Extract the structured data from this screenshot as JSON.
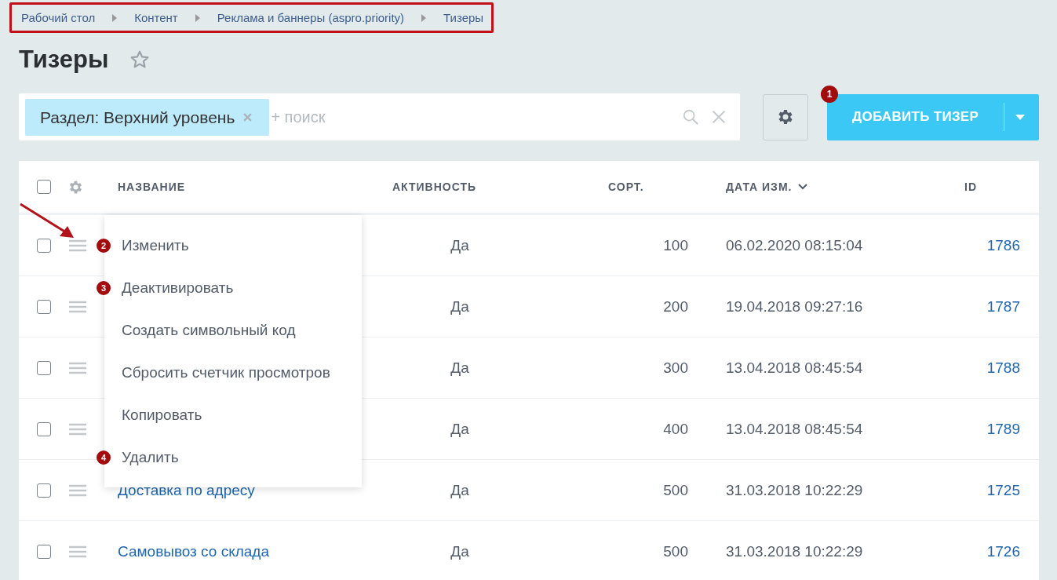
{
  "breadcrumb": {
    "outlined": true,
    "items": [
      "Рабочий стол",
      "Контент",
      "Реклама и баннеры (aspro.priority)",
      "Тизеры"
    ]
  },
  "page_title": "Тизеры",
  "starred": false,
  "filter": {
    "tag": "Раздел: Верхний уровень",
    "placeholder": "+ поиск"
  },
  "add_button": {
    "label": "ДОБАВИТЬ ТИЗЕР",
    "badge": "1"
  },
  "table": {
    "all_checked": false,
    "columns": [
      {
        "label": "НАЗВАНИЕ",
        "sorted": false
      },
      {
        "label": "АКТИВНОСТЬ",
        "sorted": false
      },
      {
        "label": "СОРТ.",
        "sorted": false
      },
      {
        "label": "ДАТА ИЗМ.",
        "sorted": true
      },
      {
        "label": "ID",
        "sorted": false
      }
    ],
    "rows": [
      {
        "checked": false,
        "active": "Да",
        "sort": "100",
        "date": "06.02.2020 08:15:04",
        "id": "1786"
      },
      {
        "checked": false,
        "active": "Да",
        "sort": "200",
        "date": "19.04.2018 09:27:16",
        "id": "1787"
      },
      {
        "checked": false,
        "active": "Да",
        "sort": "300",
        "date": "13.04.2018 08:45:54",
        "id": "1788"
      },
      {
        "checked": false,
        "active": "Да",
        "sort": "400",
        "date": "13.04.2018 08:45:54",
        "id": "1789"
      },
      {
        "checked": false,
        "name": "Доставка по адресу",
        "active": "Да",
        "sort": "500",
        "date": "31.03.2018 10:22:29",
        "id": "1725"
      },
      {
        "checked": false,
        "name": "Самовывоз со склада",
        "active": "Да",
        "sort": "500",
        "date": "31.03.2018 10:22:29",
        "id": "1726"
      }
    ]
  },
  "context_menu": {
    "items": [
      {
        "label": "Изменить",
        "badge": "2"
      },
      {
        "label": "Деактивировать",
        "badge": "3"
      },
      {
        "label": "Создать символьный код"
      },
      {
        "label": "Сбросить счетчик просмотров"
      },
      {
        "label": "Копировать"
      },
      {
        "label": "Удалить",
        "badge": "4"
      }
    ]
  },
  "pointer_arrow": true
}
